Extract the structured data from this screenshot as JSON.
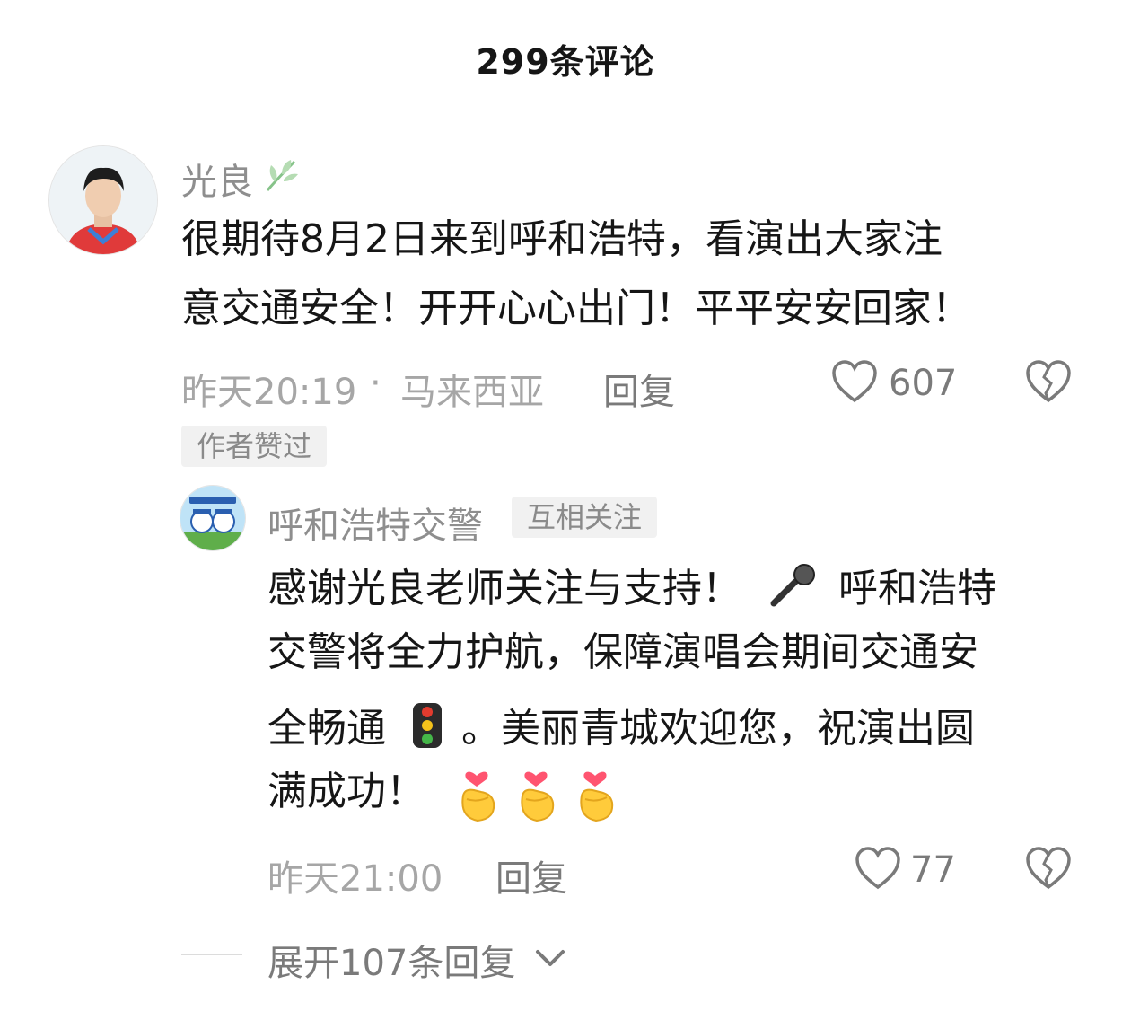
{
  "header": {
    "title": "299条评论"
  },
  "comment": {
    "user": "光良",
    "text_line1": "很期待8月2日来到呼和浩特，看演出大家注",
    "text_line2": "意交通安全！开开心心出门！平平安安回家！",
    "time": "昨天20:19",
    "separator": "·",
    "location": "马来西亚",
    "reply_label": "回复",
    "likes": "607",
    "author_liked_tag": "作者赞过"
  },
  "reply": {
    "user": "呼和浩特交警",
    "mutual_tag": "互相关注",
    "line1_a": "感谢光良老师关注与支持！",
    "line1_b": "呼和浩特",
    "line2": "交警将全力护航，保障演唱会期间交通安",
    "line3_a": "全畅通",
    "line3_b": "。美丽青城欢迎您，祝演出圆",
    "line4": "满成功！",
    "time": "昨天21:00",
    "reply_label": "回复",
    "likes": "77"
  },
  "expand": {
    "label": "展开107条回复"
  },
  "icons": [
    "leaf-icon",
    "heart-icon",
    "broken-heart-icon",
    "microphone-emoji",
    "traffic-light-emoji",
    "finger-heart-emoji",
    "chevron-down-icon"
  ],
  "colors": {
    "text": "#161616",
    "meta": "#a6a6a6",
    "tag_bg": "#f1f1f1"
  }
}
